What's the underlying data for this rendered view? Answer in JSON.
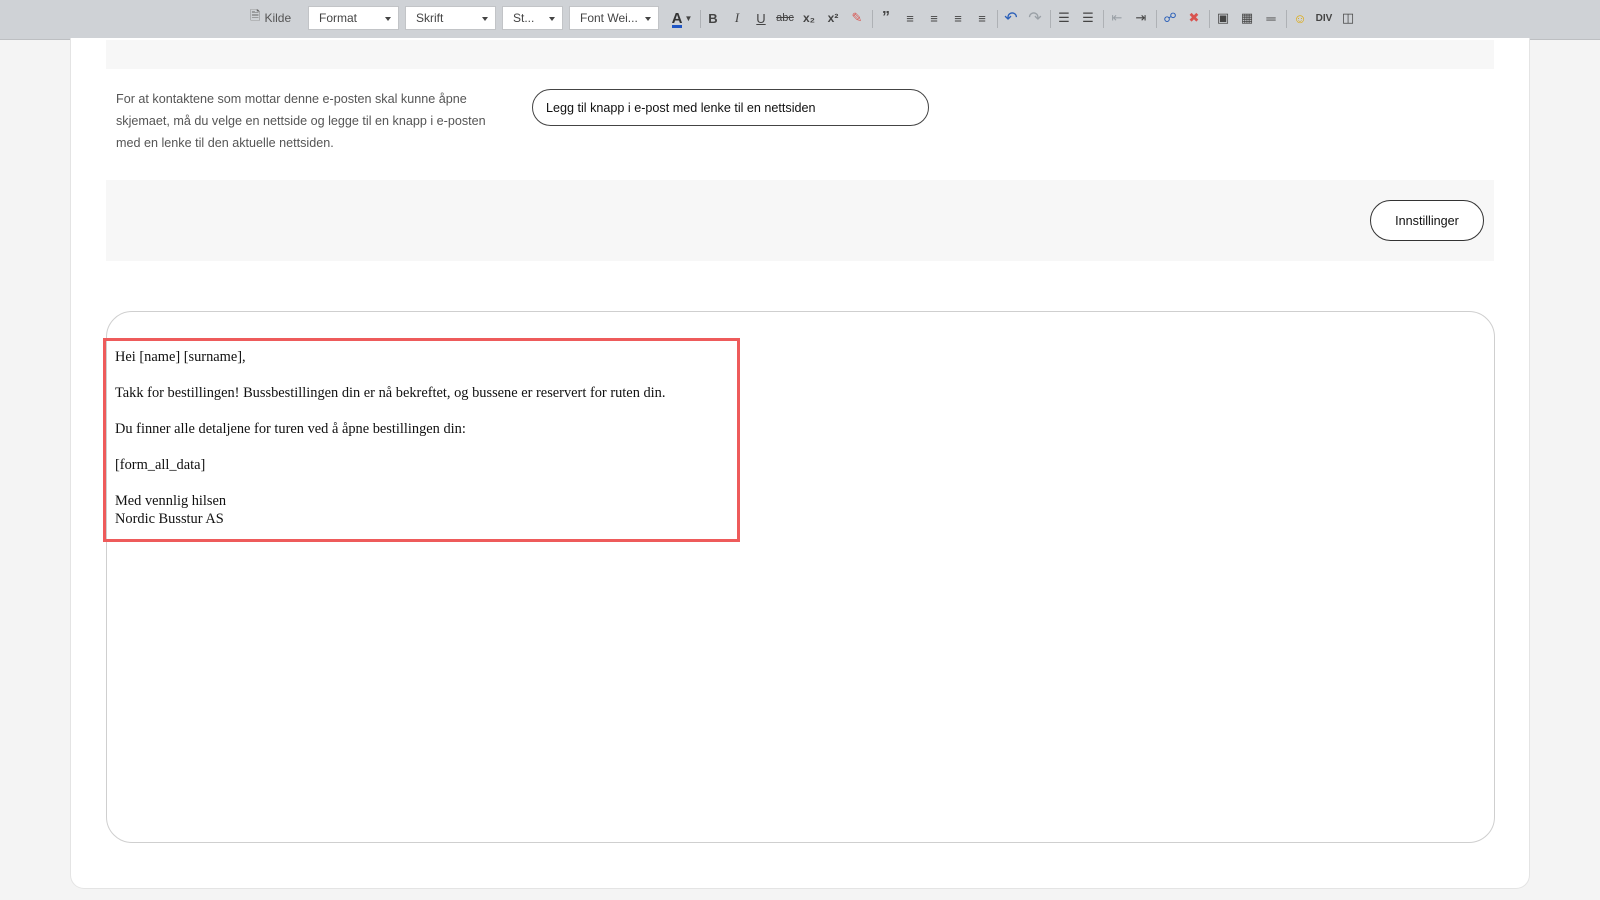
{
  "toolbar": {
    "source_label": "Kilde",
    "format_select": "Format",
    "font_select": "Skrift",
    "size_select": "St...",
    "weight_select": "Font Wei...",
    "font_color_glyph": "A",
    "bold_glyph": "B",
    "italic_glyph": "I",
    "underline_glyph": "U",
    "strike_glyph": "abc",
    "subscript_glyph": "x₂",
    "superscript_glyph": "x²",
    "icons": [
      "source-icon",
      "remove-format-icon",
      "blockquote-icon",
      "align-left-icon",
      "align-center-icon",
      "align-right-icon",
      "justify-icon",
      "undo-icon",
      "redo-icon",
      "numbered-list-icon",
      "bulleted-list-icon",
      "outdent-icon",
      "indent-icon",
      "link-icon",
      "unlink-icon",
      "image-icon",
      "table-icon",
      "horizontal-rule-icon",
      "emoji-icon",
      "div-icon",
      "show-blocks-icon"
    ]
  },
  "form": {
    "help_text": "For at kontaktene som mottar denne e-posten skal kunne åpne skjemaet, må du velge en nettside og legge til en knapp i e-posten med en lenke til den aktuelle nettsiden.",
    "link_button_label": "Legg til knapp i e-post med lenke til en nettsiden",
    "settings_button_label": "Innstillinger"
  },
  "email": {
    "greeting": "Hei [name] [surname],",
    "line1": "Takk for bestillingen! Bussbestillingen din er nå bekreftet, og bussene er reservert for ruten din.",
    "line2": "Du finner alle detaljene for turen ved å åpne bestillingen din:",
    "placeholder": "[form_all_data]",
    "closing": "Med vennlig hilsen",
    "signature": "Nordic Busstur AS"
  },
  "colors": {
    "highlight": "#ee5b5b",
    "toolbar_bg": "#cfd2d6",
    "accent_blue": "#2a5fb8"
  }
}
